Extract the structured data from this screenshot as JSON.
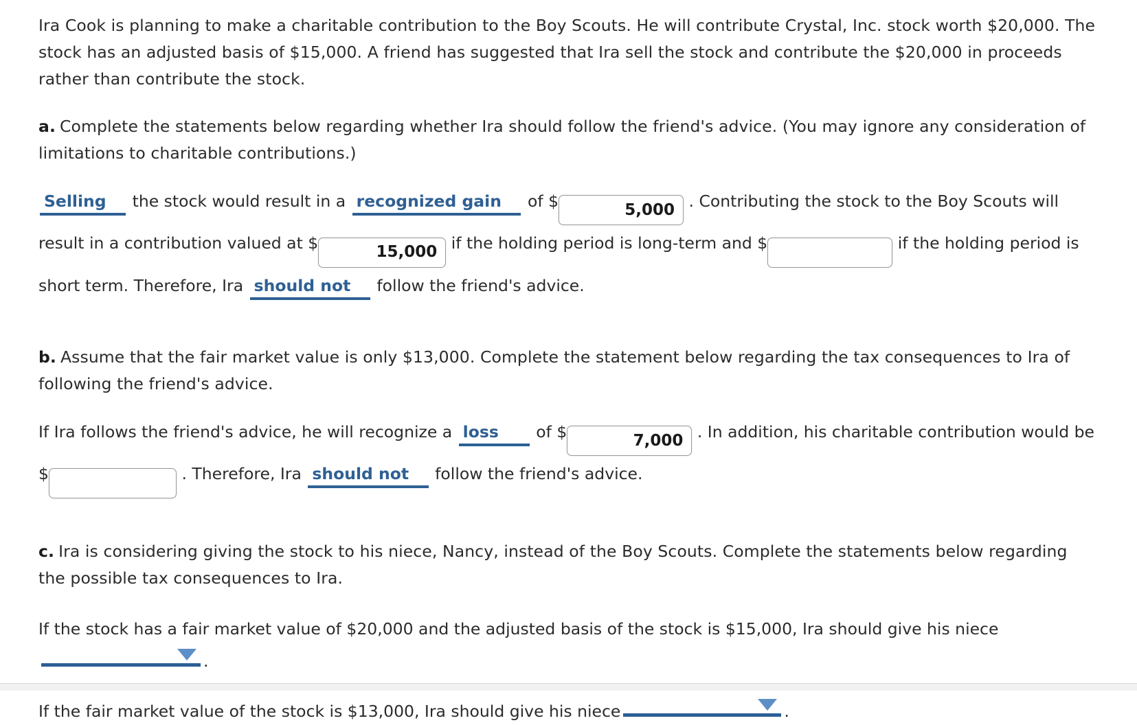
{
  "problem": {
    "intro": "Ira Cook is planning to make a charitable contribution to the Boy Scouts. He will contribute Crystal, Inc. stock worth $20,000. The stock has an adjusted basis of $15,000. A friend has suggested that Ira sell the stock and contribute the $20,000 in proceeds rather than contribute the stock."
  },
  "part_a": {
    "label": "a.",
    "prompt": "Complete the statements below regarding whether Ira should follow the friend's advice. (You may ignore any consideration of limitations to charitable contributions.)",
    "statement": {
      "dropdown_action": "Selling",
      "text_1": "the stock would result in a",
      "dropdown_result": "recognized gain",
      "text_2": "of $",
      "input_gain": "5,000",
      "text_3": ". Contributing the stock to the Boy Scouts will result in a contribution valued at $",
      "input_longterm": "15,000",
      "text_4": "if the holding period is long-term and $",
      "input_shortterm": "",
      "text_5": "if the holding period is short term. Therefore, Ira",
      "dropdown_advice": "should not",
      "text_6": "follow the friend's advice."
    }
  },
  "part_b": {
    "label": "b.",
    "prompt": "Assume that the fair market value is only $13,000. Complete the statement below regarding the tax consequences to Ira of following the friend's advice.",
    "statement": {
      "text_1": "If Ira follows the friend's advice, he will recognize a",
      "dropdown_result": "loss",
      "text_2": "of $",
      "input_loss": "7,000",
      "text_3": ". In addition, his charitable contribution would be $",
      "input_contribution": "",
      "text_4": ". Therefore, Ira",
      "dropdown_advice": "should not",
      "text_5": "follow the friend's advice."
    }
  },
  "part_c": {
    "label": "c.",
    "prompt": "Ira is considering giving the stock to his niece, Nancy, instead of the Boy Scouts. Complete the statements below regarding the possible tax consequences to Ira.",
    "line_1": {
      "text": "If the stock has a fair market value of $20,000 and the adjusted basis of the stock is $15,000, Ira should give his niece",
      "dropdown_value": "",
      "suffix": "."
    },
    "line_2": {
      "text": "If the fair market value of the stock is $13,000, Ira should give his niece",
      "dropdown_value": "",
      "suffix": "."
    }
  },
  "icons": {
    "dropdown_caret": "chevron-down-icon"
  },
  "colors": {
    "dropdown_text": "#2e6094",
    "dropdown_underline": "#2c5f96",
    "caret": "#5d8ec8",
    "body_text": "#2b2b2b",
    "input_border": "#9a9a9a"
  }
}
